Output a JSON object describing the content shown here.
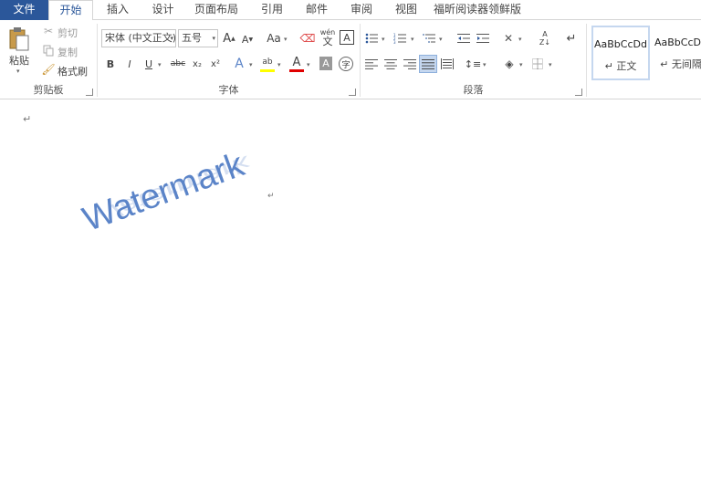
{
  "tabs": [
    {
      "label": "文件",
      "id": "file"
    },
    {
      "label": "开始",
      "id": "home"
    },
    {
      "label": "插入",
      "id": "insert"
    },
    {
      "label": "设计",
      "id": "design"
    },
    {
      "label": "页面布局",
      "id": "layout"
    },
    {
      "label": "引用",
      "id": "references"
    },
    {
      "label": "邮件",
      "id": "mailings"
    },
    {
      "label": "审阅",
      "id": "review"
    },
    {
      "label": "视图",
      "id": "view"
    },
    {
      "label": "福昕阅读器领鲜版",
      "id": "foxit"
    }
  ],
  "clipboard": {
    "paste": "粘贴",
    "cut": "剪切",
    "copy": "复制",
    "format_painter": "格式刷",
    "group": "剪贴板"
  },
  "font": {
    "name": "宋体 (中文正文)",
    "size": "五号",
    "group": "字体",
    "bold": "B",
    "italic": "I",
    "underline": "U",
    "strike": "abc",
    "subscript": "x₂",
    "superscript": "x²",
    "grow": "A",
    "shrink": "A",
    "case": "Aa",
    "phonetic": "wén",
    "phonetic_sub": "文",
    "border_char": "A",
    "text_effect": "A",
    "highlight": "ab",
    "font_color": "A",
    "shading": "A",
    "enclose": "字"
  },
  "paragraph": {
    "group": "段落"
  },
  "styles": [
    {
      "sample": "AaBbCcDd",
      "name": "↵ 正文"
    },
    {
      "sample": "AaBbCcDd",
      "name": "↵ 无间隔"
    }
  ],
  "document": {
    "paragraph_mark": "↵",
    "watermark_text": "Watermark",
    "watermark_mark": "↵"
  },
  "colors": {
    "accent": "#2b579a",
    "highlight_bar": "#ffff00",
    "font_color_bar": "#e00000",
    "watermark": "#5b84c8"
  }
}
